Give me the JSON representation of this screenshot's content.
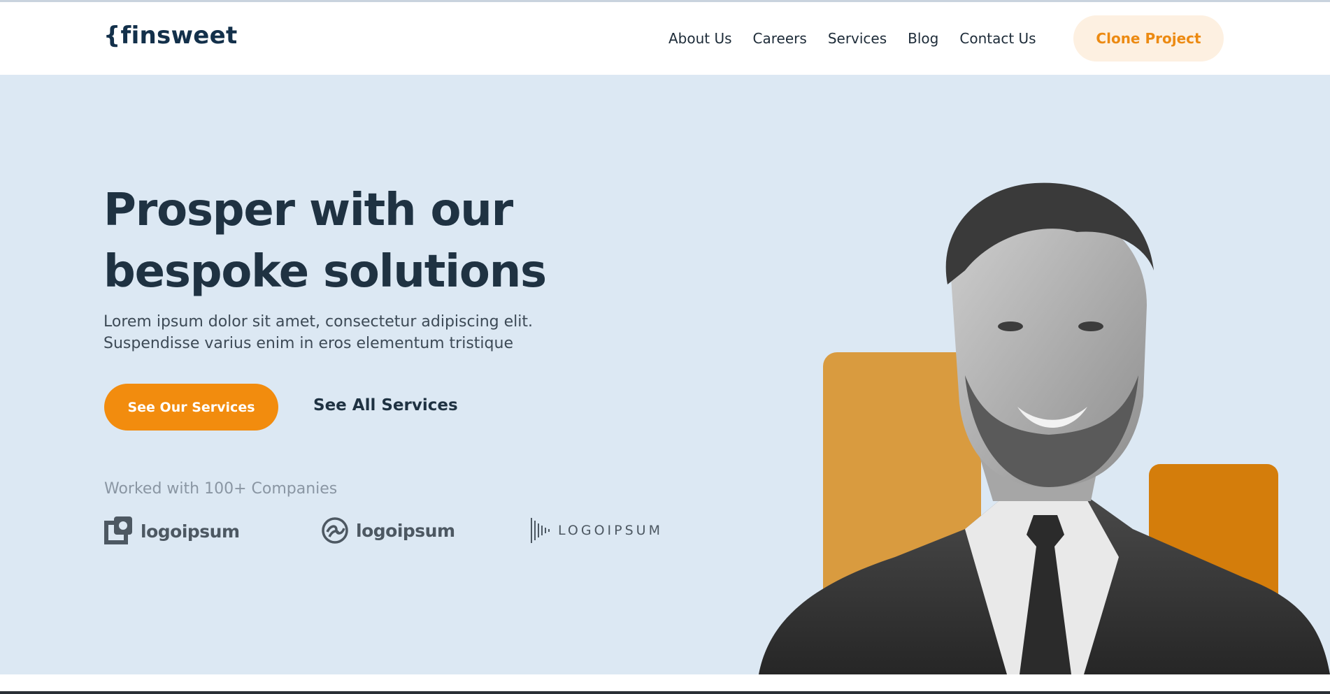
{
  "header": {
    "logo": "{finsweet",
    "nav": [
      "About Us",
      "Careers",
      "Services",
      "Blog",
      "Contact Us"
    ],
    "cta": "Clone Project"
  },
  "hero": {
    "title": "Prosper with our bespoke solutions",
    "subtitle_line1": "Lorem ipsum dolor sit amet, consectetur adipiscing elit.",
    "subtitle_line2": "Suspendisse varius enim in eros elementum tristique",
    "primary_button": "See Our Services",
    "secondary_link": "See All Services",
    "worked_with": "Worked with 100+ Companies",
    "brands": [
      "logoipsum",
      "logoipsum",
      "LOGOIPSUM"
    ]
  },
  "colors": {
    "accent": "#f28c0e",
    "hero_bg": "#dce8f3",
    "heading": "#1f3242"
  }
}
